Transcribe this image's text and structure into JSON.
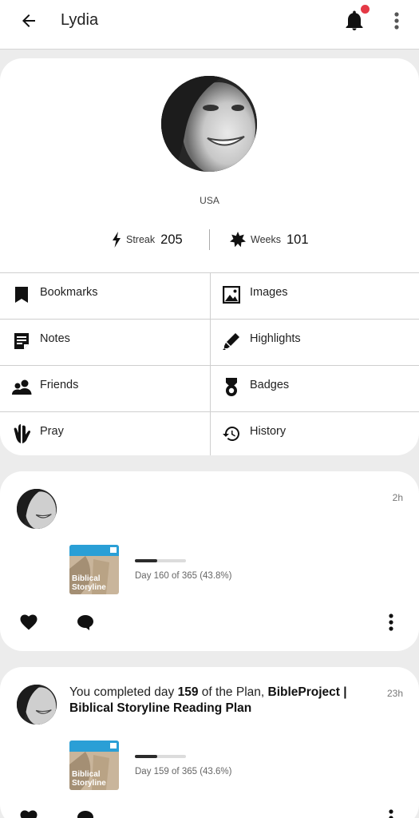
{
  "header": {
    "title": "Lydia",
    "back_icon": "arrow-left-icon",
    "notifications_icon": "bell-icon",
    "menu_icon": "more-vertical-icon",
    "badge_color": "#e53946"
  },
  "profile": {
    "country": "USA",
    "streak": {
      "label": "Streak",
      "value": "205",
      "icon": "lightning-icon"
    },
    "weeks": {
      "label": "Weeks",
      "value": "101",
      "icon": "star-burst-icon"
    }
  },
  "menu": [
    {
      "label": "Bookmarks",
      "icon": "bookmark-icon"
    },
    {
      "label": "Images",
      "icon": "image-icon"
    },
    {
      "label": "Notes",
      "icon": "note-icon"
    },
    {
      "label": "Highlights",
      "icon": "highlighter-icon"
    },
    {
      "label": "Friends",
      "icon": "friends-icon"
    },
    {
      "label": "Badges",
      "icon": "badge-medal-icon"
    },
    {
      "label": "Pray",
      "icon": "praying-hands-icon"
    },
    {
      "label": "History",
      "icon": "history-icon"
    }
  ],
  "feed": [
    {
      "time": "2h",
      "text_prefix": "",
      "day": "",
      "text_mid": "",
      "plan_name": "",
      "thumb_title_line1": "Biblical",
      "thumb_title_line2": "Storyline",
      "progress_text": "Day 160 of 365 (43.8%)",
      "progress_fraction": 0.438
    },
    {
      "time": "23h",
      "text_prefix": "You completed day ",
      "day": "159",
      "text_mid": " of the Plan, ",
      "plan_name": "BibleProject | Biblical Storyline Reading Plan",
      "thumb_title_line1": "Biblical",
      "thumb_title_line2": "Storyline",
      "progress_text": "Day 159 of 365 (43.6%)",
      "progress_fraction": 0.436
    }
  ]
}
